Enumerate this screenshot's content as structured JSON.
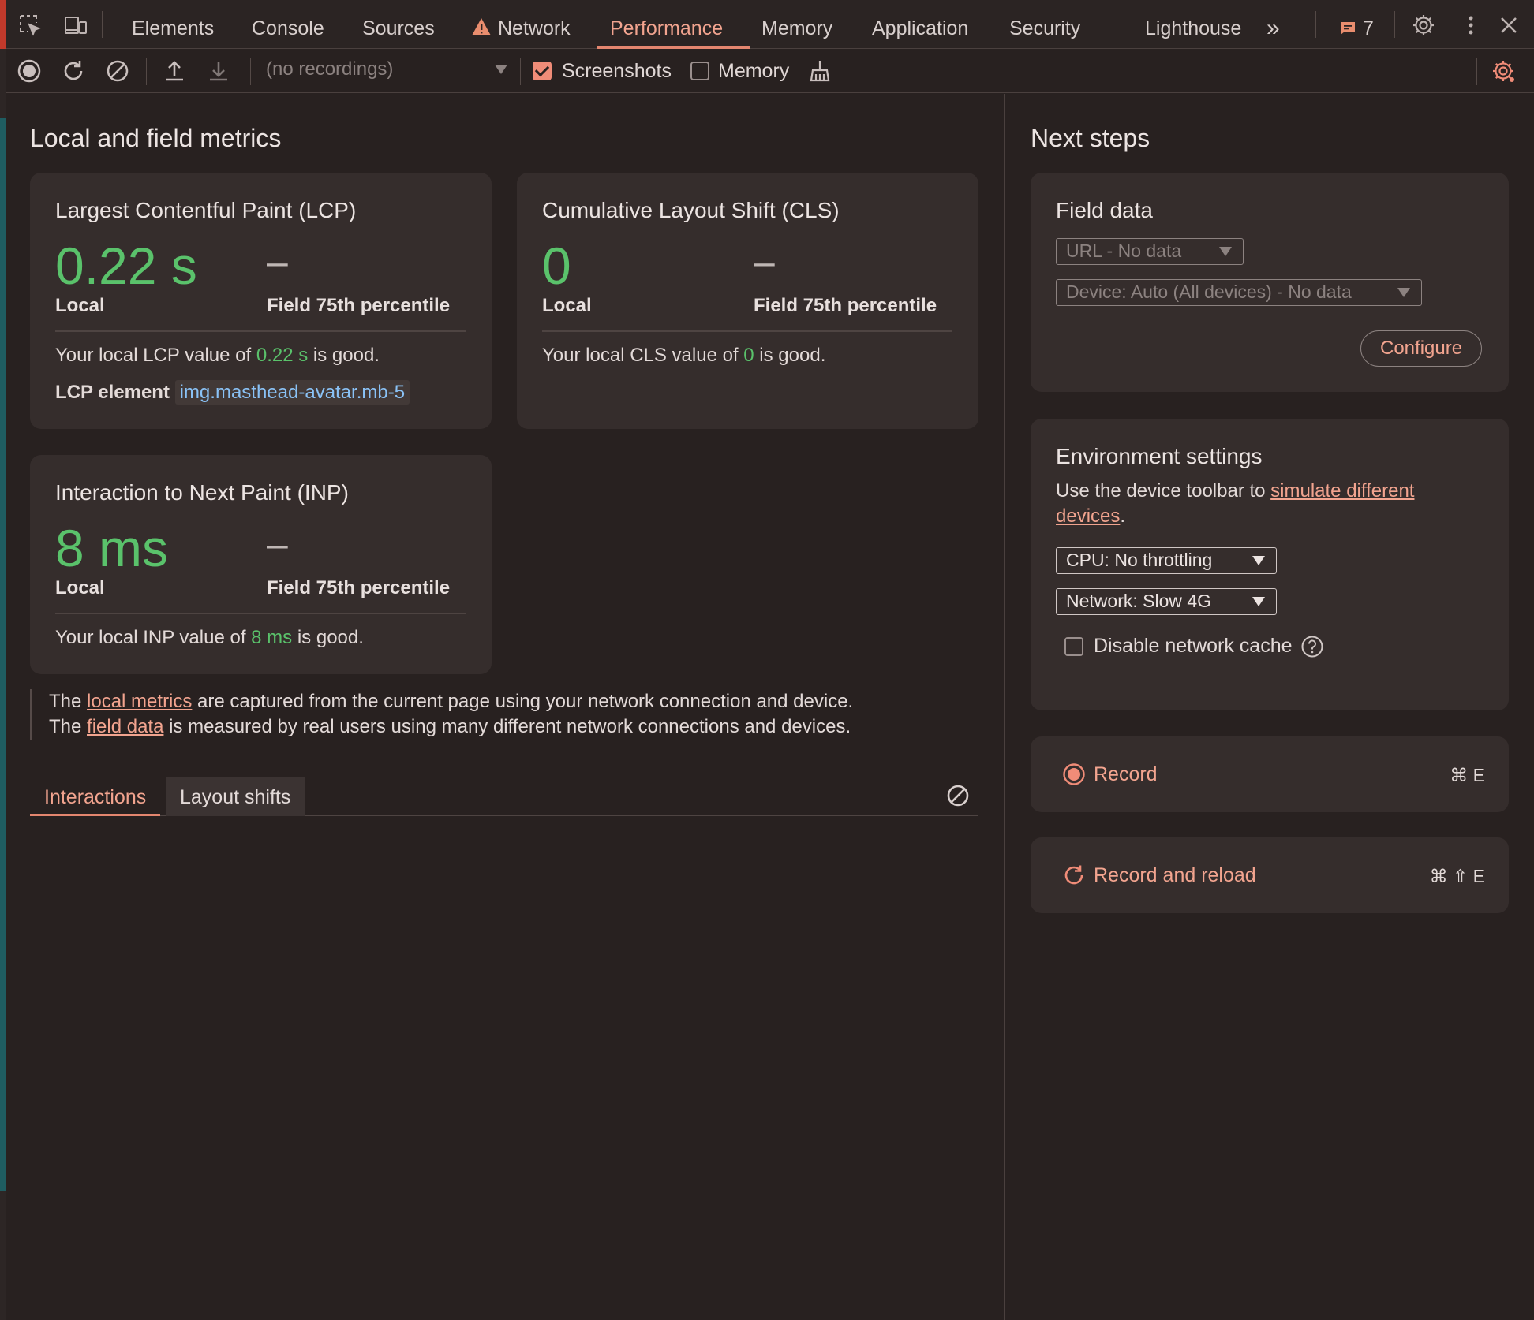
{
  "tabs": {
    "items": [
      "Elements",
      "Console",
      "Sources",
      "Network",
      "Performance",
      "Memory",
      "Application",
      "Security",
      "Lighthouse"
    ],
    "more": "»",
    "issues_count": "7"
  },
  "toolbar": {
    "recordings_placeholder": "(no recordings)",
    "screenshots_label": "Screenshots",
    "screenshots_checked": true,
    "memory_label": "Memory",
    "memory_checked": false
  },
  "left": {
    "heading": "Local and field metrics",
    "lcp": {
      "title": "Largest Contentful Paint (LCP)",
      "value": "0.22 s",
      "field_value": "–",
      "local_label": "Local",
      "field_label": "Field 75th percentile",
      "desc_prefix": "Your local LCP value of ",
      "desc_value": "0.22 s",
      "desc_suffix": " is good.",
      "element_label": "LCP element",
      "element_value": "img.masthead-avatar.mb-5"
    },
    "cls": {
      "title": "Cumulative Layout Shift (CLS)",
      "value": "0",
      "field_value": "–",
      "local_label": "Local",
      "field_label": "Field 75th percentile",
      "desc_prefix": "Your local CLS value of ",
      "desc_value": "0",
      "desc_suffix": " is good."
    },
    "inp": {
      "title": "Interaction to Next Paint (INP)",
      "value": "8 ms",
      "field_value": "–",
      "local_label": "Local",
      "field_label": "Field 75th percentile",
      "desc_prefix": "Your local INP value of ",
      "desc_value": "8 ms",
      "desc_suffix": " is good."
    },
    "info": {
      "line1_a": "The ",
      "line1_link": "local metrics",
      "line1_b": " are captured from the current page using your network connection and device.",
      "line2_a": "The ",
      "line2_link": "field data",
      "line2_b": " is measured by real users using many different network connections and devices."
    },
    "subtabs": [
      "Interactions",
      "Layout shifts"
    ]
  },
  "right": {
    "heading": "Next steps",
    "field_data": {
      "title": "Field data",
      "url_select": "URL - No data",
      "device_select": "Device: Auto (All devices) - No data",
      "configure": "Configure"
    },
    "env": {
      "title": "Environment settings",
      "desc_a": "Use the device toolbar to ",
      "desc_link1": "simulate different",
      "desc_link2": "devices",
      "desc_b": ".",
      "cpu_select": "CPU: No throttling",
      "network_select": "Network: Slow 4G",
      "cache_label": "Disable network cache",
      "cache_checked": false
    },
    "record": {
      "label": "Record",
      "shortcut": "⌘ E"
    },
    "record_reload": {
      "label": "Record and reload",
      "shortcut": "⌘ ⇧ E"
    }
  },
  "colors": {
    "accent": "#f2a48f",
    "good": "#5ac26b",
    "link_blue": "#8ac2f6",
    "background": "#282120",
    "card": "#352d2c"
  }
}
